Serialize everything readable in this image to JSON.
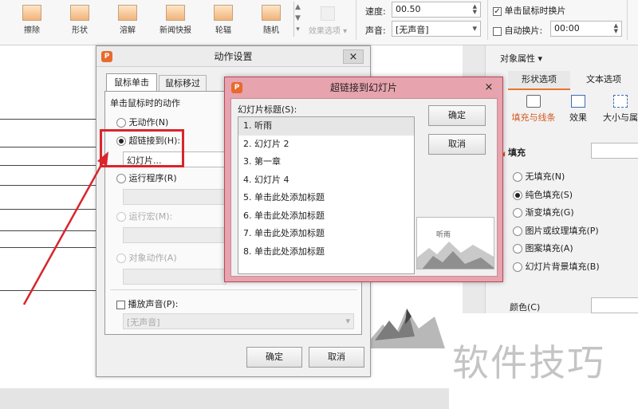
{
  "ribbon": {
    "buttons": [
      {
        "label": "擦除",
        "icon": "wipe-icon"
      },
      {
        "label": "形状",
        "icon": "shape-icon"
      },
      {
        "label": "溶解",
        "icon": "dissolve-icon"
      },
      {
        "label": "新闻快报",
        "icon": "newsflash-icon"
      },
      {
        "label": "轮辐",
        "icon": "wheel-icon"
      },
      {
        "label": "随机",
        "icon": "random-icon"
      }
    ],
    "effect_options_label": "效果选项",
    "speed_label": "速度:",
    "speed_value": "00.50",
    "sound_label": "声音:",
    "sound_value": "[无声音]",
    "advance_on_click_label": "单击鼠标时换片",
    "auto_advance_label": "自动换片:",
    "auto_advance_value": "00:00"
  },
  "panel": {
    "title": "对象属性",
    "tab_shape": "形状选项",
    "tab_text": "文本选项",
    "sub_fill_line": "填充与线条",
    "sub_effect": "效果",
    "sub_size": "大小与属",
    "fill_label": "填充",
    "fill_options": [
      "无填充(N)",
      "纯色填充(S)",
      "渐变填充(G)",
      "图片或纹理填充(P)",
      "图案填充(A)",
      "幻灯片背景填充(B)"
    ],
    "selected_fill_index": 1,
    "color_label": "颜色(C)"
  },
  "action_dialog": {
    "title": "动作设置",
    "tab_click": "鼠标单击",
    "tab_hover": "鼠标移过",
    "group_label": "单击鼠标时的动作",
    "opt_none": "无动作(N)",
    "opt_hyperlink": "超链接到(H):",
    "hyperlink_value": "幻灯片...",
    "opt_run_program": "运行程序(R)",
    "opt_run_macro": "运行宏(M):",
    "opt_object_action": "对象动作(A)",
    "play_sound_label": "播放声音(P):",
    "sound_value": "[无声音]",
    "ok": "确定",
    "cancel": "取消"
  },
  "hyperlink_dialog": {
    "title": "超链接到幻灯片",
    "list_label": "幻灯片标题(S):",
    "slides": [
      "1. 听雨",
      "2. 幻灯片 2",
      "3. 第一章",
      "4. 幻灯片 4",
      "5. 单击此处添加标题",
      "6. 单击此处添加标题",
      "7. 单击此处添加标题",
      "8. 单击此处添加标题"
    ],
    "selected_index": 0,
    "preview_text": "听雨",
    "ok": "确定",
    "cancel": "取消"
  },
  "watermark": "软件技巧"
}
